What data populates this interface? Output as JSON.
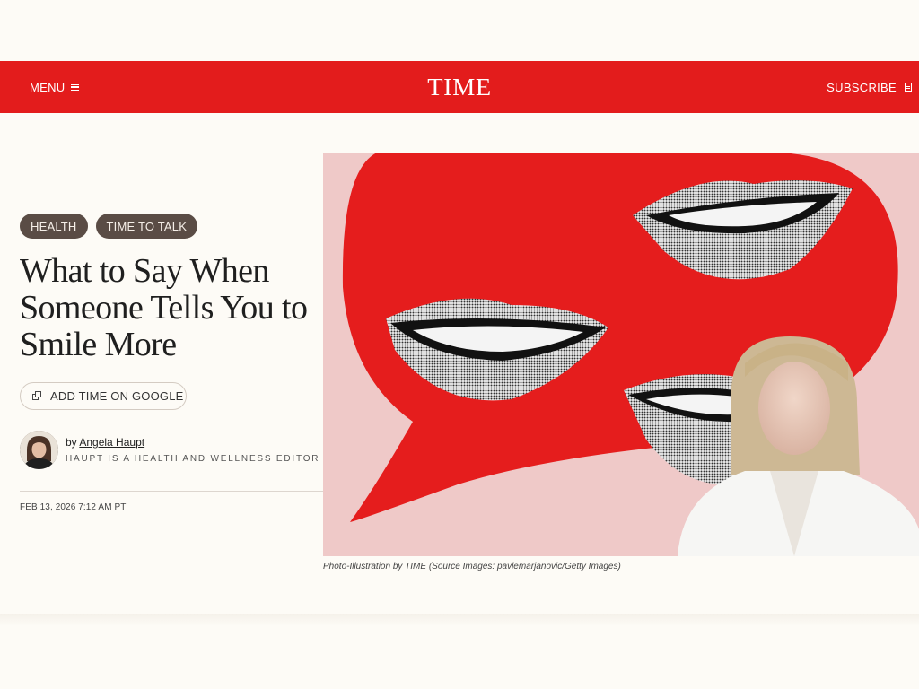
{
  "header": {
    "menu_label": "MENU",
    "logo": "TIME",
    "subscribe_label": "SUBSCRIBE"
  },
  "article": {
    "tags": [
      "HEALTH",
      "TIME TO TALK"
    ],
    "headline": "What to Say When Someone Tells You to Smile More",
    "google_button_label": "ADD TIME ON GOOGLE",
    "byline_prefix": "by",
    "author": "Angela Haupt",
    "author_bio": "HAUPT IS A HEALTH AND WELLNESS EDITOR AT TIME",
    "date": "FEB 13, 2026 7:12 AM PT",
    "image_caption": "Photo-Illustration by TIME (Source Images: pavlemarjanovic/Getty Images)"
  },
  "colors": {
    "brand_red": "#e31c1c",
    "tag_bg": "#5a4c45",
    "background": "#fdfbf6"
  },
  "icons": [
    "menu-icon",
    "subscribe-icon",
    "add-source-icon"
  ]
}
